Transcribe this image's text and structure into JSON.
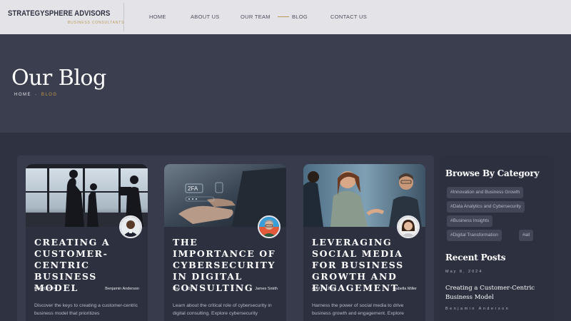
{
  "header": {
    "logo_name": "STRATEGYSPHERE ADVISORS",
    "logo_tagline": "BUSINESS CONSULTANTS",
    "nav": [
      {
        "label": "HOME",
        "active": false
      },
      {
        "label": "ABOUT US",
        "active": false
      },
      {
        "label": "OUR TEAM",
        "active": false
      },
      {
        "label": "BLOG",
        "active": true
      },
      {
        "label": "CONTACT US",
        "active": false
      }
    ]
  },
  "hero": {
    "title": "Our Blog",
    "breadcrumb": {
      "home": "HOME",
      "separator": "-",
      "current": "BLOG"
    }
  },
  "posts": [
    {
      "title": "Creating a Customer-Centric Business Model",
      "date": "May 8, 2024",
      "author": "Benjamin Anderson",
      "excerpt": "Discover the keys to creating a customer-centric business model that prioritizes"
    },
    {
      "title": "The Importance of Cybersecurity in Digital Consulting",
      "date": "May 5, 2024",
      "author": "James Smith",
      "excerpt": "Learn about the critical role of cybersecurity in digital consulting. Explore cybersecurity"
    },
    {
      "title": "Leveraging Social Media for Business Growth and Engagement",
      "date": "April 20, 2024",
      "author": "Isabella Miller",
      "excerpt": "Harness the power of social media to drive business growth and engagement. Explore"
    }
  ],
  "sidebar": {
    "category_heading": "Browse By Category",
    "categories": [
      "#Innovation and Business Growth",
      "#Data Analytics and Cybersecurity",
      "#Business Insights",
      "#Digital Transformation",
      "#all"
    ],
    "recent_heading": "Recent Posts",
    "recent": [
      {
        "date": "May 8, 2024",
        "title": "Creating a Customer-Centric Business Model",
        "author": "Benjamin Anderson"
      }
    ]
  },
  "colors": {
    "accent": "#c69a45",
    "header_bg": "#e4e4e8",
    "hero_bg": "#3b3e4e",
    "card_bg": "#2d303f",
    "page_bg": "#2f3240"
  }
}
